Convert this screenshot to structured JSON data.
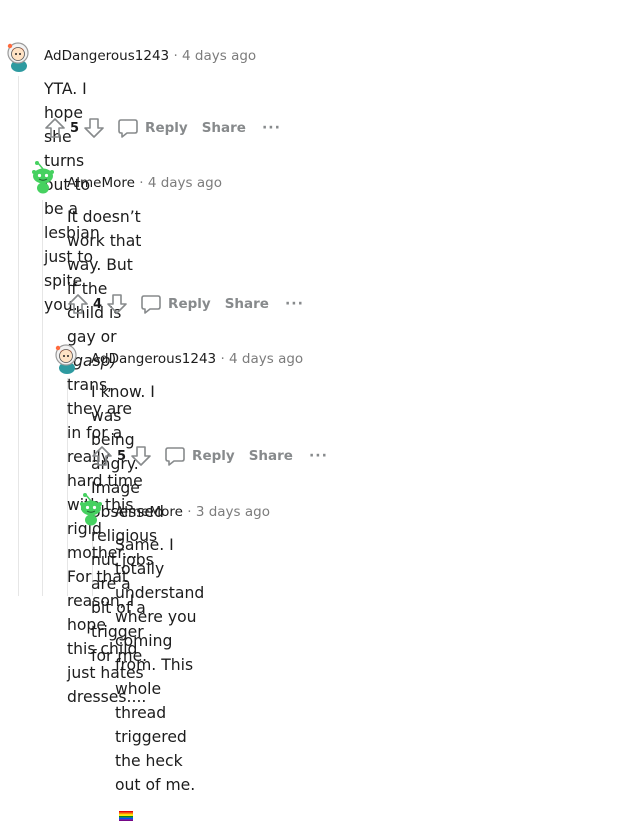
{
  "comments": [
    {
      "author": "AdDangerous1243",
      "separator": "·",
      "time": "4 days ago",
      "lines": [
        "YTA. I hope she turns out to be a lesbian just to spite you."
      ],
      "votes": "5",
      "reply_label": "Reply",
      "share_label": "Share",
      "more_label": "···"
    },
    {
      "author": "AlmeMore",
      "separator": "·",
      "time": "4 days ago",
      "line1_pre": "It doesn’t work that way. But if the child is gay or ",
      "line1_em": "(gasp)",
      "line1_post": " trans, they are",
      "line2": "in for a really hard time with this rigid mother... For that reason, I hope",
      "line3": "this child just hates dresses....",
      "votes": "4",
      "reply_label": "Reply",
      "share_label": "Share",
      "more_label": "···"
    },
    {
      "author": "AdDangerous1243",
      "separator": "·",
      "time": "4 days ago",
      "lines": [
        "I know. I was being angry. Image obsessed religious nut jobs are a",
        "bit of a trigger for me."
      ],
      "votes": "5",
      "reply_label": "Reply",
      "share_label": "Share",
      "more_label": "···"
    },
    {
      "author": "AlmeMore",
      "separator": "·",
      "time": "3 days ago",
      "lines": [
        "Same. I totally understand where you coming from. This whole",
        "thread triggered the heck out of me."
      ],
      "emoji": "rainbow-flag-icon"
    }
  ],
  "colors": {
    "text": "#1c1c1c",
    "muted": "#7c7c7c",
    "action": "#878a8c",
    "thread_line": "#e6e6e6",
    "avatar_green": "#46d160"
  }
}
